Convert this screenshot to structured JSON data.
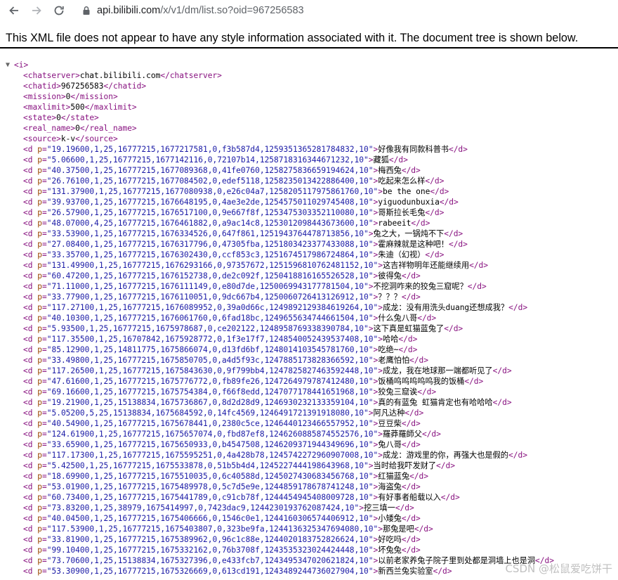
{
  "browser": {
    "url_host": "api.bilibili.com",
    "url_path": "/x/v1/dm/list.so?oid=967256583"
  },
  "banner_text": "This XML file does not appear to have any style information associated with it. The document tree is shown below.",
  "xml": {
    "root_tag": "i",
    "elements": [
      {
        "tag": "chatserver",
        "text": "chat.bilibili.com"
      },
      {
        "tag": "chatid",
        "text": "967256583"
      },
      {
        "tag": "mission",
        "text": "0"
      },
      {
        "tag": "maxlimit",
        "text": "500"
      },
      {
        "tag": "state",
        "text": "0"
      },
      {
        "tag": "real_name",
        "text": "0"
      },
      {
        "tag": "source",
        "text": "k-v"
      }
    ],
    "danmaku": [
      {
        "p": "19.19600,1,25,16777215,1677217581,0,f3b587d4,1259351365281784832,10",
        "text": "好像我有同款科普书"
      },
      {
        "p": "5.06600,1,25,16777215,1677142116,0,72107b14,1258718316344671232,10",
        "text": "藏狐"
      },
      {
        "p": "40.37500,1,25,16777215,1677089368,0,41fe0760,1258275836659194624,10",
        "text": "梅西兔"
      },
      {
        "p": "26.76100,1,25,16777215,1677084502,0,edef5118,1258235013422886400,10",
        "text": "吃起来怎么样"
      },
      {
        "p": "131.37900,1,25,16777215,1677080938,0,e26c04a7,1258205117975861760,10",
        "text": "be the one"
      },
      {
        "p": "39.93700,1,25,16777215,1676648195,0,4ae3e2de,1254575011029745408,10",
        "text": "yiguodunbuxia"
      },
      {
        "p": "26.57900,1,25,16777215,1676517100,0,9e667f8f,1253475303352110080,10",
        "text": "哥斯拉长毛兔"
      },
      {
        "p": "48.07000,4,25,16777215,1676461882,0,a9ac14c8,1253012098443673600,10",
        "text": "rabeeit"
      },
      {
        "p": "33.53900,1,25,16777215,1676334526,0,647f861,1251943764478713856,10",
        "text": "兔之大，一锅炖不下"
      },
      {
        "p": "27.08400,1,25,16777215,1676317796,0,47305fba,1251803423377433088,10",
        "text": "霍麻辣就是这种吧！"
      },
      {
        "p": "33.35700,1,25,16777215,1676302430,0,ccf853c3,1251674517986724864,10",
        "text": "朱迪（幻视）"
      },
      {
        "p": "131.49900,1,25,16777215,1676293166,0,97357672,1251596810762481152,10",
        "text": "这吉祥物明年还能继续用"
      },
      {
        "p": "60.47200,1,25,16777215,1676152738,0,de2c092f,1250418816165526528,10",
        "text": "彼得兔"
      },
      {
        "p": "71.11000,1,25,16777215,1676111149,0,e80d7de,1250069943177781504,10",
        "text": "不挖洞咋来的狡兔三窟呢？"
      },
      {
        "p": "33.77900,1,25,16777215,1676110051,0,9dc667b4,1250060726413126912,10",
        "text": "？？？"
      },
      {
        "p": "117.27100,1,25,16777215,1676089952,0,39a0d66c,1249892129384619264,10",
        "text": "成龙：没有用洗头duang还想成我？"
      },
      {
        "p": "40.10300,1,25,16777215,1676061760,0,6fad18bc,1249655634744661504,10",
        "text": "什么兔八哥"
      },
      {
        "p": "5.93500,1,25,16777215,1675978687,0,ce202122,1248958769338390784,10",
        "text": "这下真是虹猫蓝兔了"
      },
      {
        "p": "117.35500,1,25,16707842,1675928772,0,1f3e17f7,1248540052439537408,10",
        "text": "哈哈"
      },
      {
        "p": "85.12900,1,25,14811775,1675866074,0,d13fd6bf,1248014103545781760,10",
        "text": "吃绝~"
      },
      {
        "p": "33.49800,1,25,16777215,1675850705,0,a4d5f93c,1247885173828366592,10",
        "text": "老鹰怕怕"
      },
      {
        "p": "117.26500,1,25,16777215,1675843630,0,9f799bb4,1247825827463592448,10",
        "text": "成龙，我在地球那一端都听见了"
      },
      {
        "p": "47.61600,1,25,16777215,1675776772,0,fb89fe26,1247264979787412480,10",
        "text": "饭桶呜呜呜呜呜我的饭桶"
      },
      {
        "p": "69.16600,1,25,16777215,1675754384,0,f66f8edd,1247077178441651968,10",
        "text": "狡兔三窟诶"
      },
      {
        "p": "19.21900,1,25,15138834,1675736867,0,8d2d28d9,1246930232133359104,10",
        "text": "真的有蓝兔 虹猫肯定也有哈哈哈"
      },
      {
        "p": "5.05200,5,25,15138834,1675684592,0,14fc4569,1246491721391918080,10",
        "text": "阿凡达种"
      },
      {
        "p": "40.54900,1,25,16777215,1675678441,0,2380c5ce,1246440123466557952,10",
        "text": "豆豆柴"
      },
      {
        "p": "124.61900,1,25,16777215,1675657074,0,fbd87ef8,1246260885874552576,10",
        "text": "羅莽羅師父"
      },
      {
        "p": "33.65900,1,25,16777215,1675650933,0,b4547508,1246209371944349696,10",
        "text": "兔八哥"
      },
      {
        "p": "117.17300,1,25,16777215,1675595251,0,4a428b78,1245742272960907008,10",
        "text": "成龙：游戏里的你，再强大也是假的"
      },
      {
        "p": "5.42500,1,25,16777215,1675533878,0,51b5b4d4,1245227444198643968,10",
        "text": "当时给我吓发财了"
      },
      {
        "p": "18.69900,1,25,16777215,1675510035,0,6c40588d,1245027430683456768,10",
        "text": "红猫蓝兔"
      },
      {
        "p": "53.01900,1,25,16777215,1675489978,0,5c7d5e9e,1244859178678741248,10",
        "text": "海盗兔"
      },
      {
        "p": "60.73400,1,25,16777215,1675441789,0,c91cb78f,1244454945408009728,10",
        "text": "有好事者船载以入"
      },
      {
        "p": "73.83200,1,25,38979,1675414997,0,7423dac9,1244230193762087424,10",
        "text": "挖三填一"
      },
      {
        "p": "40.04500,1,25,16777215,1675406666,0,1546c0e1,1244160306574406912,10",
        "text": "小矮兔"
      },
      {
        "p": "117.53900,1,25,16777215,1675403807,0,323be9fa,1244136325347694080,10",
        "text": "那兔是吧"
      },
      {
        "p": "33.81900,1,25,16777215,1675389962,0,96c1c88e,1244020183752826624,10",
        "text": "好吃吗"
      },
      {
        "p": "99.10400,1,25,16777215,1675332162,0,76b3708f,1243535323024424448,10",
        "text": "坏兔兔"
      },
      {
        "p": "73.70600,1,25,15138834,1675327396,0,e433fcb7,1243495347020621824,10",
        "text": "以前老家养兔子院子里到处都是洞墙上也是洞"
      },
      {
        "p": "53.30900,1,25,16777215,1675326669,0,613cd191,1243489244736027904,10",
        "text": "新西兰兔实验室"
      }
    ]
  },
  "watermark": "CSDN @松鼠爱吃饼干"
}
